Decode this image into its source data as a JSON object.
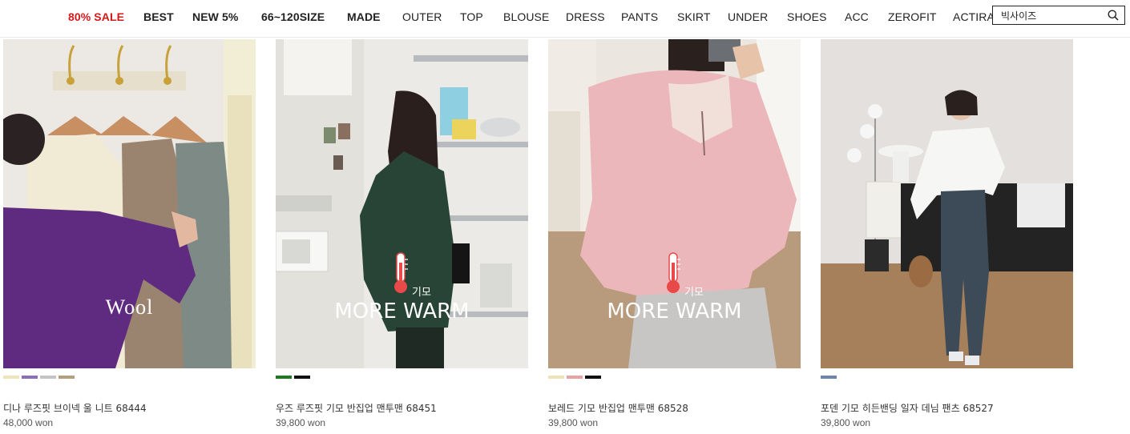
{
  "nav": {
    "items": [
      {
        "label": "80% SALE"
      },
      {
        "label": "BEST"
      },
      {
        "label": "NEW 5%"
      },
      {
        "label": "66~120SIZE"
      },
      {
        "label": "MADE"
      },
      {
        "label": "OUTER"
      },
      {
        "label": "TOP"
      },
      {
        "label": "BLOUSE"
      },
      {
        "label": "DRESS"
      },
      {
        "label": "PANTS"
      },
      {
        "label": "SKIRT"
      },
      {
        "label": "UNDER"
      },
      {
        "label": "SHOES"
      },
      {
        "label": "ACC"
      },
      {
        "label": "ZEROFIT"
      },
      {
        "label": "ACTIRAL"
      }
    ],
    "sale_color": "#d4191a"
  },
  "search": {
    "value": "빅사이즈",
    "icon": "search-icon"
  },
  "products": [
    {
      "name": "디나 루즈핏 브이넥 울 니트 68444",
      "price": "48,000 won",
      "overlay": "Wool",
      "swatches": [
        "#efe4bd",
        "#8b6fb8",
        "#c4c4c4",
        "#b39f7e"
      ]
    },
    {
      "name": "우즈 루즈핏 기모 반집업 맨투맨 68451",
      "price": "39,800 won",
      "badge_small": "기모",
      "badge_big": "MORE WARM",
      "swatches": [
        "#1d7a1d",
        "#111111"
      ]
    },
    {
      "name": "보레드 기모 반집업 맨투맨 68528",
      "price": "39,800 won",
      "badge_small": "기모",
      "badge_big": "MORE WARM",
      "swatches": [
        "#ede2b8",
        "#e7a3a3",
        "#111111"
      ]
    },
    {
      "name": "포덴 기모 히든밴딩 일자 데님 팬츠 68527",
      "price": "39,800 won",
      "swatches": [
        "#6e86ad"
      ]
    }
  ]
}
